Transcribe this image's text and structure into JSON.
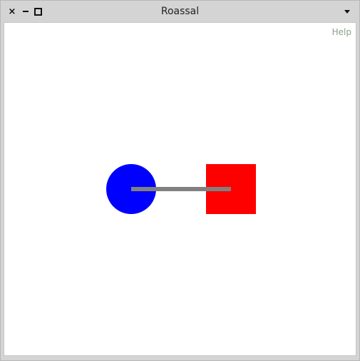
{
  "window": {
    "title": "Roassal",
    "controls": {
      "close_glyph": "×",
      "close_icon": "close-icon",
      "minimize_icon": "minimize-icon",
      "maximize_icon": "maximize-icon",
      "menu_icon": "chevron-down-icon"
    }
  },
  "canvas": {
    "help_label": "Help",
    "shapes": {
      "circle_color": "#0000ff",
      "square_color": "#ff0000",
      "edge_color": "#808080"
    }
  }
}
